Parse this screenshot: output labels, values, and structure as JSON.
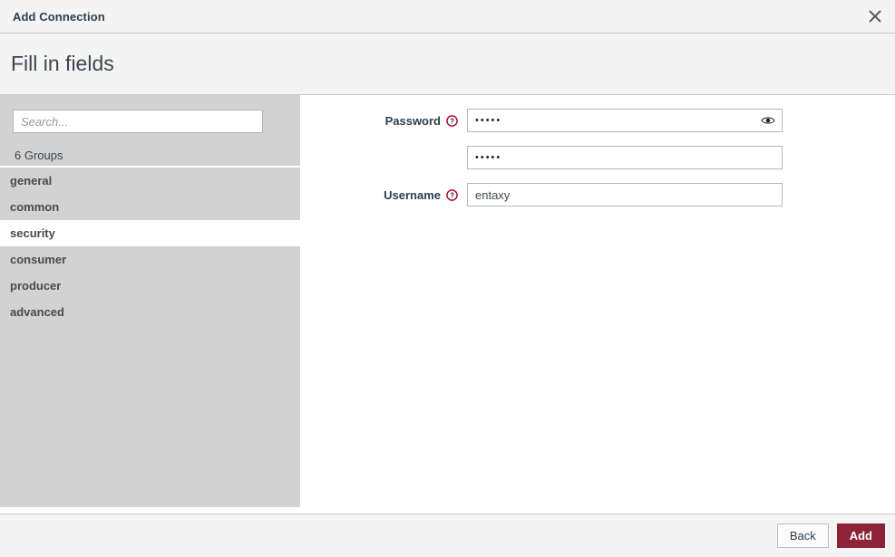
{
  "window": {
    "title": "Add Connection",
    "close_icon": "close-icon"
  },
  "step": {
    "title": "Fill in fields"
  },
  "sidebar": {
    "search": {
      "placeholder": "Search...",
      "value": ""
    },
    "groups_count_label": "6 Groups",
    "items": [
      {
        "label": "general",
        "selected": false
      },
      {
        "label": "common",
        "selected": false
      },
      {
        "label": "security",
        "selected": true
      },
      {
        "label": "consumer",
        "selected": false
      },
      {
        "label": "producer",
        "selected": false
      },
      {
        "label": "advanced",
        "selected": false
      }
    ]
  },
  "form": {
    "fields": [
      {
        "label": "Password",
        "help_icon": "help-circle-icon",
        "value": "•••••",
        "masked": true,
        "has_eye_toggle": true,
        "eye_icon": "eye-icon"
      },
      {
        "label": "",
        "help_icon": "",
        "value": "•••••",
        "masked": true,
        "has_eye_toggle": false,
        "eye_icon": ""
      },
      {
        "label": "Username",
        "help_icon": "help-circle-icon",
        "value": "entaxy",
        "masked": false,
        "has_eye_toggle": false,
        "eye_icon": ""
      }
    ]
  },
  "footer": {
    "back_label": "Back",
    "add_label": "Add"
  },
  "colors": {
    "primary": "#8c2338",
    "help_icon": "#b01030",
    "sidebar_bg": "#d2d2d2",
    "header_bg": "#f4f4f4",
    "text": "#2c3e50"
  }
}
